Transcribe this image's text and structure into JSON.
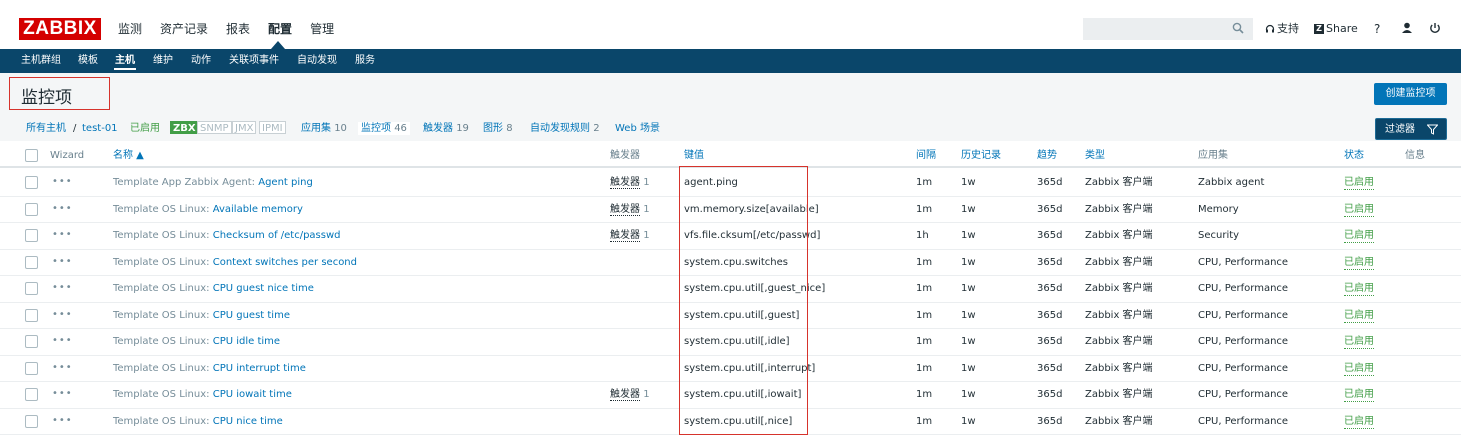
{
  "header": {
    "logo": "ZABBIX",
    "menu": [
      {
        "label": "监测"
      },
      {
        "label": "资产记录"
      },
      {
        "label": "报表"
      },
      {
        "label": "配置"
      },
      {
        "label": "管理"
      }
    ],
    "search_placeholder": "",
    "support_label": "支持",
    "share_label": "Share",
    "help_label": "?"
  },
  "subnav": {
    "items": [
      {
        "label": "主机群组"
      },
      {
        "label": "模板"
      },
      {
        "label": "主机"
      },
      {
        "label": "维护"
      },
      {
        "label": "动作"
      },
      {
        "label": "关联项事件"
      },
      {
        "label": "自动发现"
      },
      {
        "label": "服务"
      }
    ]
  },
  "page": {
    "title": "监控项",
    "create_button": "创建监控项"
  },
  "breadcrumb": {
    "all_hosts": "所有主机",
    "sep": "/",
    "host": "test-01",
    "enabled": "已启用",
    "badges": [
      "ZBX",
      "SNMP",
      "JMX",
      "IPMI"
    ],
    "tabs": [
      {
        "label": "应用集",
        "count": "10"
      },
      {
        "label": "监控项",
        "count": "46"
      },
      {
        "label": "触发器",
        "count": "19"
      },
      {
        "label": "图形",
        "count": "8"
      },
      {
        "label": "自动发现规则",
        "count": "2"
      },
      {
        "label": "Web 场景",
        "count": ""
      }
    ],
    "filter_button": "过滤器"
  },
  "table": {
    "headers": {
      "wizard": "Wizard",
      "name": "名称 ▲",
      "triggers": "触发器",
      "key": "键值",
      "interval": "间隔",
      "history": "历史记录",
      "trends": "趋势",
      "type": "类型",
      "applications": "应用集",
      "status": "状态",
      "info": "信息"
    },
    "rows": [
      {
        "prefix": "Template App Zabbix Agent:",
        "name": "Agent ping",
        "trig_label": "触发器",
        "trig_count": "1",
        "key": "agent.ping",
        "interval": "1m",
        "history": "1w",
        "trends": "365d",
        "type": "Zabbix 客户端",
        "app": "Zabbix agent",
        "status": "已启用"
      },
      {
        "prefix": "Template OS Linux:",
        "name": "Available memory",
        "trig_label": "触发器",
        "trig_count": "1",
        "key": "vm.memory.size[available]",
        "interval": "1m",
        "history": "1w",
        "trends": "365d",
        "type": "Zabbix 客户端",
        "app": "Memory",
        "status": "已启用"
      },
      {
        "prefix": "Template OS Linux:",
        "name": "Checksum of /etc/passwd",
        "trig_label": "触发器",
        "trig_count": "1",
        "key": "vfs.file.cksum[/etc/passwd]",
        "interval": "1h",
        "history": "1w",
        "trends": "365d",
        "type": "Zabbix 客户端",
        "app": "Security",
        "status": "已启用"
      },
      {
        "prefix": "Template OS Linux:",
        "name": "Context switches per second",
        "trig_label": "",
        "trig_count": "",
        "key": "system.cpu.switches",
        "interval": "1m",
        "history": "1w",
        "trends": "365d",
        "type": "Zabbix 客户端",
        "app": "CPU, Performance",
        "status": "已启用"
      },
      {
        "prefix": "Template OS Linux:",
        "name": "CPU guest nice time",
        "trig_label": "",
        "trig_count": "",
        "key": "system.cpu.util[,guest_nice]",
        "interval": "1m",
        "history": "1w",
        "trends": "365d",
        "type": "Zabbix 客户端",
        "app": "CPU, Performance",
        "status": "已启用"
      },
      {
        "prefix": "Template OS Linux:",
        "name": "CPU guest time",
        "trig_label": "",
        "trig_count": "",
        "key": "system.cpu.util[,guest]",
        "interval": "1m",
        "history": "1w",
        "trends": "365d",
        "type": "Zabbix 客户端",
        "app": "CPU, Performance",
        "status": "已启用"
      },
      {
        "prefix": "Template OS Linux:",
        "name": "CPU idle time",
        "trig_label": "",
        "trig_count": "",
        "key": "system.cpu.util[,idle]",
        "interval": "1m",
        "history": "1w",
        "trends": "365d",
        "type": "Zabbix 客户端",
        "app": "CPU, Performance",
        "status": "已启用"
      },
      {
        "prefix": "Template OS Linux:",
        "name": "CPU interrupt time",
        "trig_label": "",
        "trig_count": "",
        "key": "system.cpu.util[,interrupt]",
        "interval": "1m",
        "history": "1w",
        "trends": "365d",
        "type": "Zabbix 客户端",
        "app": "CPU, Performance",
        "status": "已启用"
      },
      {
        "prefix": "Template OS Linux:",
        "name": "CPU iowait time",
        "trig_label": "触发器",
        "trig_count": "1",
        "key": "system.cpu.util[,iowait]",
        "interval": "1m",
        "history": "1w",
        "trends": "365d",
        "type": "Zabbix 客户端",
        "app": "CPU, Performance",
        "status": "已启用"
      },
      {
        "prefix": "Template OS Linux:",
        "name": "CPU nice time",
        "trig_label": "",
        "trig_count": "",
        "key": "system.cpu.util[,nice]",
        "interval": "1m",
        "history": "1w",
        "trends": "365d",
        "type": "Zabbix 客户端",
        "app": "CPU, Performance",
        "status": "已启用"
      }
    ]
  },
  "colors": {
    "brand": "#d40000",
    "nav": "#0a466a",
    "link": "#0275b8",
    "enabled": "#429e47",
    "highlight_box": "#d6332c"
  }
}
